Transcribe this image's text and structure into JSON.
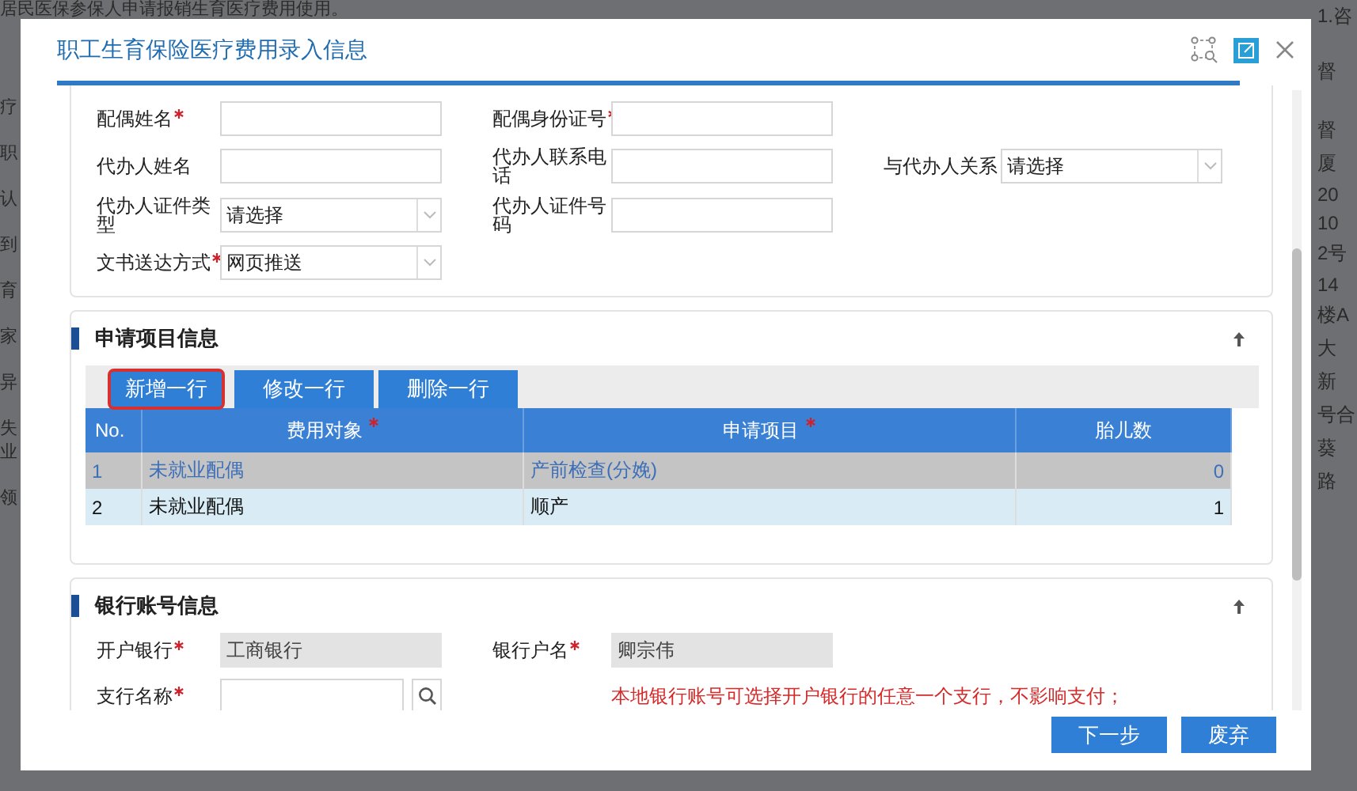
{
  "background": {
    "top_text": "居民医保参保人申请报销生育医疗费用使用。",
    "left_fragments": [
      "疗",
      "职",
      "认",
      "到",
      "育",
      "家",
      "异",
      "失业",
      "领"
    ],
    "right_fragments": [
      "1.咨",
      "督",
      "督",
      "厦",
      "20",
      "10",
      "2号",
      "14",
      "楼A",
      "大",
      "新",
      "号合",
      "葵",
      "路"
    ]
  },
  "dialog": {
    "title": "职工生育保险医疗费用录入信息",
    "sections": [
      {
        "kind": "form",
        "fields": [
          {
            "label": "配偶姓名",
            "required": true,
            "kind": "text"
          },
          {
            "label": "配偶身份证号",
            "required": true,
            "kind": "text"
          },
          {
            "kind": "blank"
          },
          {
            "label": "代办人姓名",
            "required": false,
            "kind": "text"
          },
          {
            "label": "代办人联系电话",
            "required": false,
            "kind": "text"
          },
          {
            "label": "与代办人关系",
            "required": false,
            "kind": "select",
            "value": "请选择"
          },
          {
            "label": "代办人证件类型",
            "required": false,
            "kind": "select",
            "value": "请选择"
          },
          {
            "label": "代办人证件号码",
            "required": false,
            "kind": "text"
          },
          {
            "kind": "blank"
          },
          {
            "label": "文书送达方式",
            "required": true,
            "kind": "select",
            "value": "网页推送"
          }
        ]
      },
      {
        "kind": "table",
        "title": "申请项目信息",
        "toolbar": [
          {
            "label": "新增一行",
            "highlighted": true
          },
          {
            "label": "修改一行",
            "highlighted": false
          },
          {
            "label": "删除一行",
            "highlighted": false
          }
        ],
        "columns": [
          {
            "label": "No.",
            "required": false
          },
          {
            "label": "费用对象",
            "required": true
          },
          {
            "label": "申请项目",
            "required": true
          },
          {
            "label": "胎儿数",
            "required": false
          }
        ],
        "rows": [
          {
            "selected": true,
            "cells": [
              "1",
              "未就业配偶",
              "产前检查(分娩)",
              "0"
            ]
          },
          {
            "selected": false,
            "cells": [
              "2",
              "未就业配偶",
              "顺产",
              "1"
            ]
          }
        ]
      },
      {
        "kind": "form",
        "title": "银行账号信息",
        "fields": [
          {
            "label": "开户银行",
            "required": true,
            "kind": "readonly",
            "value": "工商银行"
          },
          {
            "label": "银行户名",
            "required": true,
            "kind": "readonly",
            "value": "卿宗伟"
          },
          {
            "kind": "blank"
          },
          {
            "label": "支行名称",
            "required": true,
            "kind": "search"
          },
          {
            "kind": "note",
            "text": "本地银行账号可选择开户银行的任意一个支行，不影响支付；"
          }
        ]
      }
    ],
    "buttons": [
      "下一步",
      "废弃"
    ]
  }
}
